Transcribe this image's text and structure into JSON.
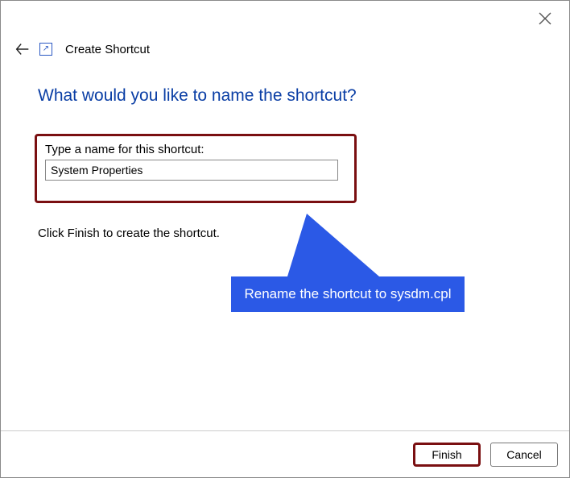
{
  "header": {
    "close_glyph": "✕",
    "wizard_title": "Create Shortcut",
    "shortcut_glyph": "↗"
  },
  "main": {
    "question": "What would you like to name the shortcut?",
    "field_label": "Type a name for this shortcut:",
    "name_value": "System Properties",
    "finish_hint": "Click Finish to create the shortcut."
  },
  "callout": {
    "text": "Rename the shortcut to sysdm.cpl"
  },
  "footer": {
    "finish_label": "Finish",
    "cancel_label": "Cancel"
  }
}
